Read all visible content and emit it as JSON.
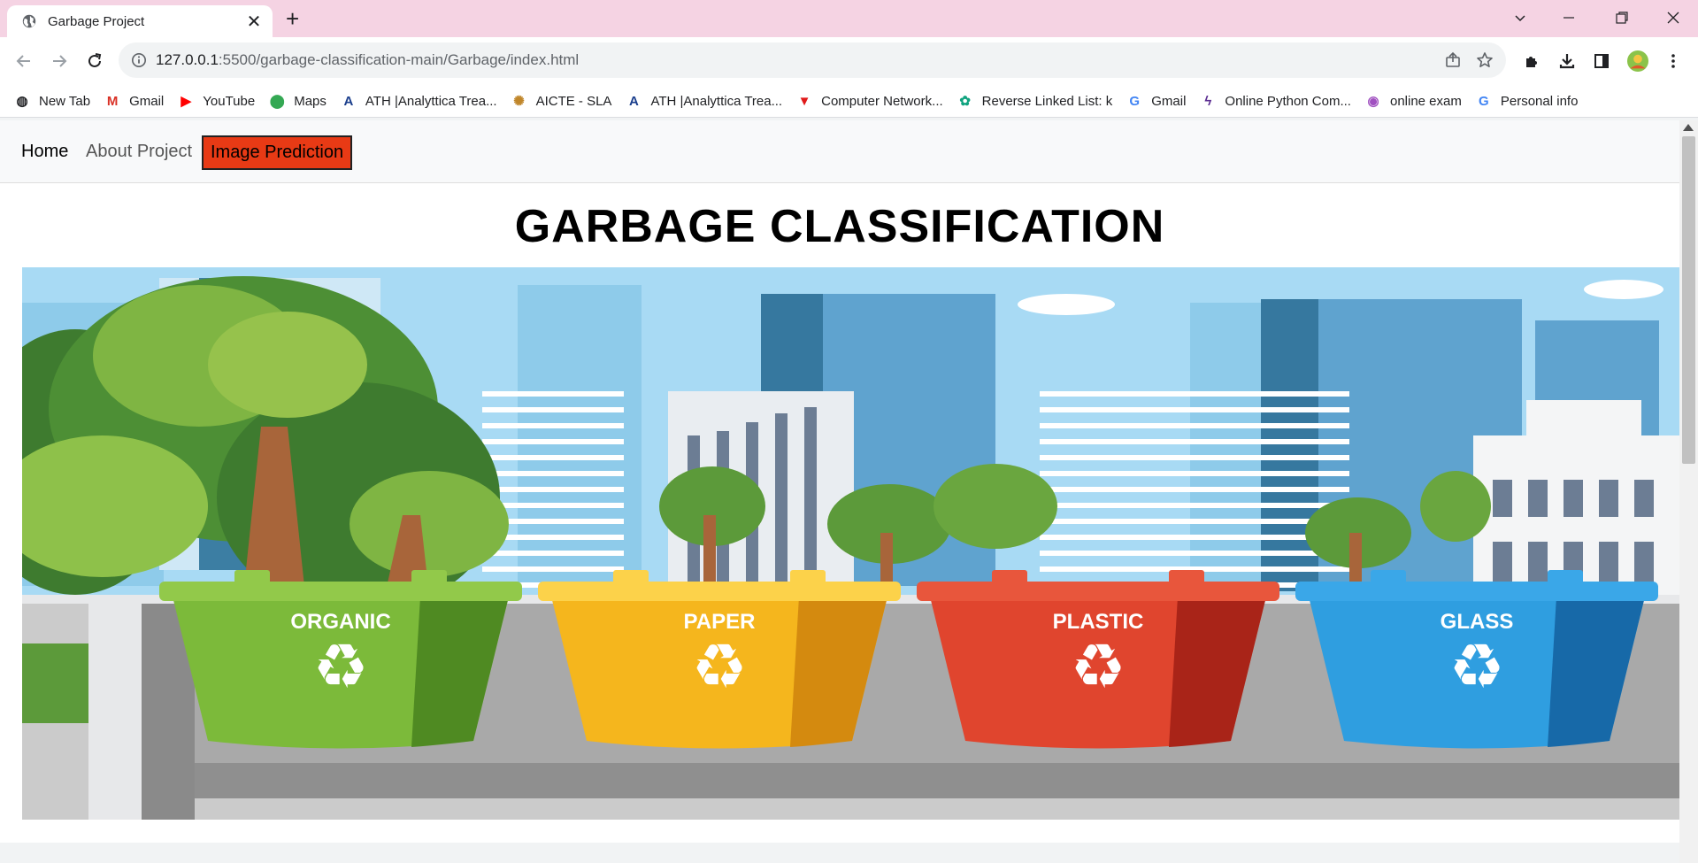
{
  "browser": {
    "tab_title": "Garbage Project",
    "url_host": "127.0.0.1",
    "url_rest": ":5500/garbage-classification-main/Garbage/index.html",
    "bookmarks": [
      {
        "label": "New Tab",
        "icon": "globe-icon",
        "color": "#202124"
      },
      {
        "label": "Gmail",
        "icon": "gmail-icon",
        "color": "#d93025"
      },
      {
        "label": "YouTube",
        "icon": "youtube-icon",
        "color": "#ff0000"
      },
      {
        "label": "Maps",
        "icon": "maps-icon",
        "color": "#34a853"
      },
      {
        "label": "ATH |Analyttica Trea...",
        "icon": "ath-icon",
        "color": "#1a3e8c"
      },
      {
        "label": "AICTE - SLA",
        "icon": "aicte-icon",
        "color": "#c0862a"
      },
      {
        "label": "ATH |Analyttica Trea...",
        "icon": "ath-icon",
        "color": "#1a3e8c"
      },
      {
        "label": "Computer Network...",
        "icon": "triangle-icon",
        "color": "#e01a1a"
      },
      {
        "label": "Reverse Linked List: k",
        "icon": "chatgpt-icon",
        "color": "#10a37f"
      },
      {
        "label": "Gmail",
        "icon": "google-icon",
        "color": "#4285f4"
      },
      {
        "label": "Online Python Com...",
        "icon": "bolt-icon",
        "color": "#5b2d91"
      },
      {
        "label": "online exam",
        "icon": "pin-icon",
        "color": "#a050c0"
      },
      {
        "label": "Personal info",
        "icon": "google-icon",
        "color": "#4285f4"
      }
    ]
  },
  "nav": {
    "home": "Home",
    "about": "About Project",
    "predict": "Image Prediction"
  },
  "main": {
    "title": "GARBAGE CLASSIFICATION",
    "bins": [
      {
        "label": "ORGANIC",
        "color": "#7cba3a",
        "dark": "#4f8a22",
        "lid": "#92c94a"
      },
      {
        "label": "PAPER",
        "color": "#f5b61d",
        "dark": "#d48a0f",
        "lid": "#fcd24a"
      },
      {
        "label": "PLASTIC",
        "color": "#e0452e",
        "dark": "#a92418",
        "lid": "#e8563c"
      },
      {
        "label": "GLASS",
        "color": "#2f9ee0",
        "dark": "#1769a8",
        "lid": "#3aa7e8"
      }
    ]
  },
  "colors": {
    "titlebar": "#f5d3e3",
    "predict_button": "#e83a15",
    "sky": "#a8daf4"
  }
}
